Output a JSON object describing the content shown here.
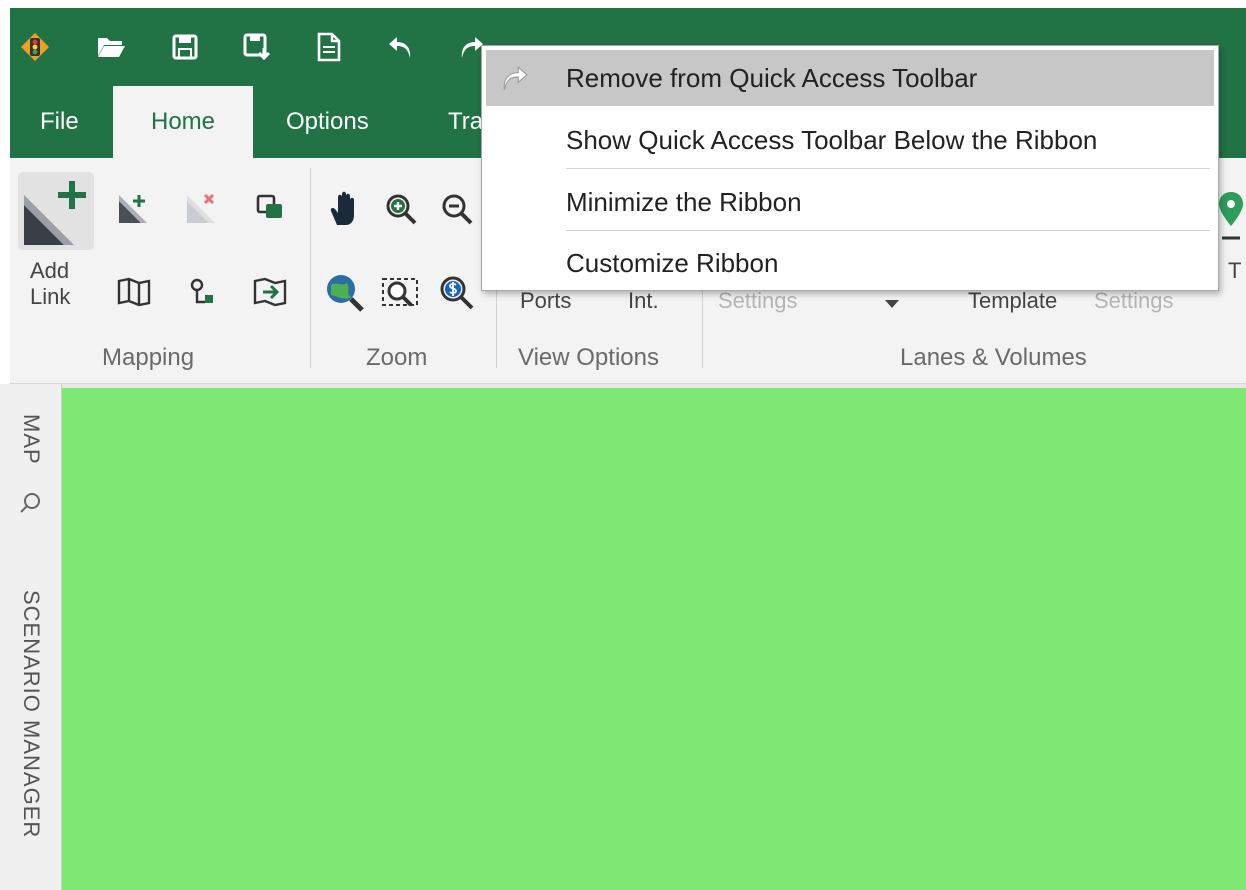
{
  "quick_access": {
    "icons": [
      "app-logo-icon",
      "open-folder-icon",
      "save-icon",
      "save-as-icon",
      "new-document-icon",
      "undo-icon",
      "redo-icon",
      "customize-qat-icon"
    ]
  },
  "tabs": [
    {
      "label": "File",
      "active": false
    },
    {
      "label": "Home",
      "active": true
    },
    {
      "label": "Options",
      "active": false
    },
    {
      "label": "Tra",
      "active": false
    }
  ],
  "ribbon": {
    "mapping": {
      "label": "Mapping",
      "add_link_line1": "Add",
      "add_link_line2": "Link"
    },
    "zoom": {
      "label": "Zoom"
    },
    "view_options": {
      "label": "View Options",
      "ports_label": "Ports",
      "int_label": "Int."
    },
    "lanes_volumes": {
      "label": "Lanes & Volumes",
      "settings_label": "Settings",
      "template_label": "Template",
      "settings2_label": "Settings",
      "partial_t": "T"
    }
  },
  "left_rail": {
    "map_label": "MAP",
    "scenario_label": "SCENARIO MANAGER"
  },
  "colors": {
    "brand_green": "#217346",
    "canvas_green": "#7de974",
    "ribbon_bg": "#f3f3f3",
    "menu_hover": "#c7c7c7"
  },
  "context_menu": {
    "items": [
      {
        "label": "Remove from Quick Access Toolbar",
        "icon": "redo-icon",
        "highlighted": true
      },
      {
        "label": "Show Quick Access Toolbar Below the Ribbon",
        "highlighted": false
      },
      {
        "label": "Minimize the Ribbon",
        "highlighted": false
      },
      {
        "label": "Customize Ribbon",
        "highlighted": false
      }
    ]
  }
}
